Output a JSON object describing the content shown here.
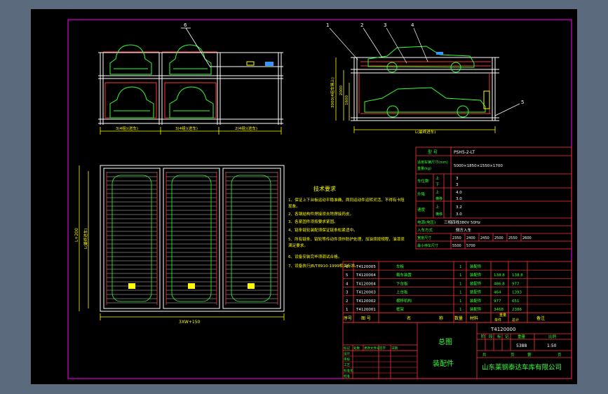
{
  "colors": {
    "background": "#5b6b7d",
    "sheet": "#000000",
    "frame_border": "#ff00ff",
    "table_lines": "#ff3333",
    "text_green": "#33ff33",
    "text_yellow": "#ffff00",
    "structure": "#ffffff",
    "cars": "#33ff33",
    "dimensions": "#ffff00"
  },
  "front_view": {
    "label_6": "6",
    "dims": [
      "3(4组)(进车)",
      "3(4组)(进车)",
      "2(4组)(进车)"
    ]
  },
  "side_view": {
    "callouts": [
      "1",
      "2",
      "3",
      "4",
      "5"
    ],
    "dims": {
      "top": "3000(4组车辆上)",
      "mid": "2000",
      "low": "1600",
      "bottom": "L(最终进车)"
    }
  },
  "plan_view": {
    "dim_left": "L+200",
    "dim_left2": "L(最终进车)",
    "dim_bottom": "3XW+150"
  },
  "tech_req": {
    "title": "技术要求",
    "lines": [
      "1、保证上下台板运动平稳准确，两同运动件运转灵活，不得有卡阻",
      "   现象。",
      "2、各钢结构件焊接须去除焊接药皮。",
      "3、各紧固件须按要求紧固。",
      "4、链条链轮装配须保证链条松紧适中。",
      "5、所有链条、链轮等传动件须作防护处理，加油须按规程，油漆须",
      "   满足要求。",
      "6、设备安装完毕须调试合格。",
      "7、设备执行JB/T8910-1999相关标准。"
    ]
  },
  "spec_table": {
    "title_left": "型 号",
    "title_right": "PSH5-2-LT",
    "rows": [
      {
        "label": "适用车辆尺寸(mm)",
        "label2": "重量(kg)",
        "value": "5000×1850×1550×1700"
      },
      {
        "label": "车位数",
        "sub": [
          [
            "上",
            "3"
          ],
          [
            "下",
            "3"
          ]
        ]
      },
      {
        "label": "升降",
        "sub": [
          [
            "上",
            "4.0"
          ],
          [
            "横移",
            "3.0"
          ]
        ]
      },
      {
        "label": "速度",
        "sub": [
          [
            "上",
            "3.2"
          ],
          [
            "横移",
            "3.0"
          ]
        ]
      },
      {
        "label": "电源(电压)",
        "value": "三相四线380V 50Hz"
      },
      {
        "label": "入车方式",
        "value": "侧方入车"
      },
      {
        "label": "宽度尺寸",
        "values": [
          "2350",
          "2400",
          "2450",
          "2500",
          "2550",
          "2600"
        ]
      },
      {
        "label": "最小停车尺寸",
        "values": [
          "5500",
          "5700"
        ]
      }
    ]
  },
  "bom": {
    "header": [
      "序号",
      "图 号",
      "名",
      "称",
      "数量",
      "材料",
      "",
      "单件",
      "总计",
      "备注"
    ],
    "header_sub": "重量",
    "rows": [
      {
        "no": "6",
        "code": "T4120005",
        "name": "车板",
        "qty": "1",
        "mat": "装配件",
        "w1": "",
        "w2": ""
      },
      {
        "no": "5",
        "code": "T4120004",
        "name": "载车装置",
        "qty": "1",
        "mat": "装配件",
        "w1": "138.8",
        "w2": "138.8"
      },
      {
        "no": "4",
        "code": "T4120004",
        "name": "下台板",
        "qty": "1",
        "mat": "装配件",
        "w1": "486.8",
        "w2": "977"
      },
      {
        "no": "3",
        "code": "T4120003",
        "name": "上台板",
        "qty": "1",
        "mat": "装配件",
        "w1": "464",
        "w2": "1393"
      },
      {
        "no": "2",
        "code": "T4120002",
        "name": "横移机构",
        "qty": "1",
        "mat": "装配件",
        "w1": "977",
        "w2": "651"
      },
      {
        "no": "1",
        "code": "T4120001",
        "name": "框架",
        "qty": "1",
        "mat": "装配件",
        "w1": "3468",
        "w2": "2386"
      }
    ]
  },
  "title_block": {
    "drawing_no": "T4120000",
    "name_line1": "总图",
    "name_line2": "装配件",
    "stage_labels": [
      "阶",
      "段",
      "标",
      "记"
    ],
    "weight_label": "重量",
    "scale_label": "比例",
    "weight": "5388",
    "scale": "1:50",
    "sheet_labels": [
      "共",
      "页",
      "第",
      "页"
    ],
    "company": "山东莱钢泰达车库有限公司",
    "sign_rows": [
      "标记",
      "处数",
      "更改文件号",
      "签字",
      "日期",
      "设计",
      "审核",
      "工艺",
      "标准化",
      "批准"
    ]
  }
}
